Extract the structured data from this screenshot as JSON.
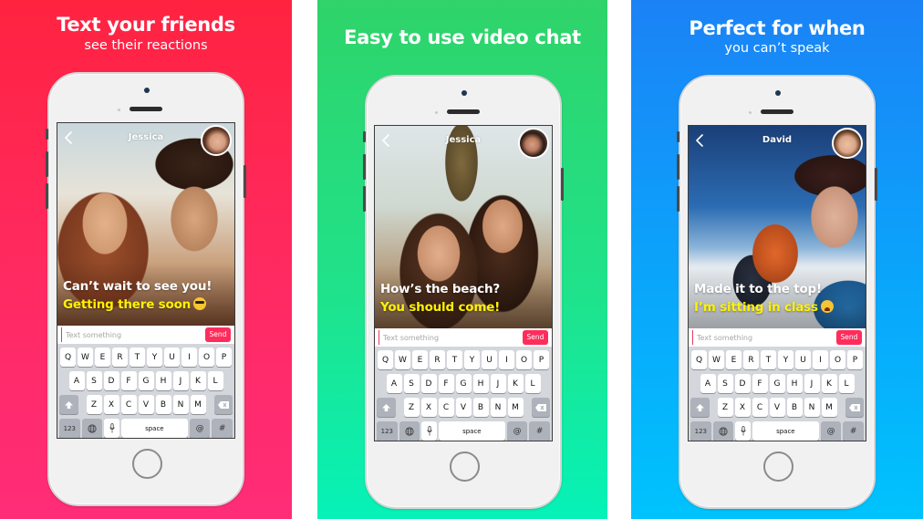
{
  "panels": [
    {
      "headline": "Text your friends",
      "subline": "see their reactions",
      "background_color": "#ff2340",
      "phone": {
        "contact_name": "Jessica",
        "message_line_1": "Can’t wait to see you!",
        "message_line_2": "Getting there soon",
        "emoji": "smiling-face-with-sunglasses",
        "input_placeholder": "Text something",
        "send_label": "Send"
      }
    },
    {
      "headline": "Easy to use video chat",
      "subline": "",
      "background_color": "#2fd369",
      "phone": {
        "contact_name": "Jessica",
        "message_line_1": "How’s the beach?",
        "message_line_2": "You should come!",
        "emoji": "",
        "input_placeholder": "Text something",
        "send_label": "Send"
      }
    },
    {
      "headline": "Perfect for when",
      "subline": "you can’t speak",
      "background_color": "#1b82f6",
      "phone": {
        "contact_name": "David",
        "message_line_1": "Made it to the top!",
        "message_line_2": "I’m sitting in class",
        "emoji": "weary-face",
        "input_placeholder": "Text something",
        "send_label": "Send"
      }
    }
  ],
  "keyboard": {
    "row1": [
      "Q",
      "W",
      "E",
      "R",
      "T",
      "Y",
      "U",
      "I",
      "O",
      "P"
    ],
    "row2": [
      "A",
      "S",
      "D",
      "F",
      "G",
      "H",
      "J",
      "K",
      "L"
    ],
    "row3": [
      "Z",
      "X",
      "C",
      "V",
      "B",
      "N",
      "M"
    ],
    "numbers_label": "123",
    "space_label": "space",
    "at_label": "@",
    "hash_label": "#",
    "shift_icon": "shift-arrow",
    "delete_icon": "backspace",
    "globe_icon": "globe",
    "mic_icon": "microphone"
  },
  "colors": {
    "send_button": "#ff2d5c",
    "message_highlight": "#fff200",
    "message_primary": "#ffffff"
  }
}
